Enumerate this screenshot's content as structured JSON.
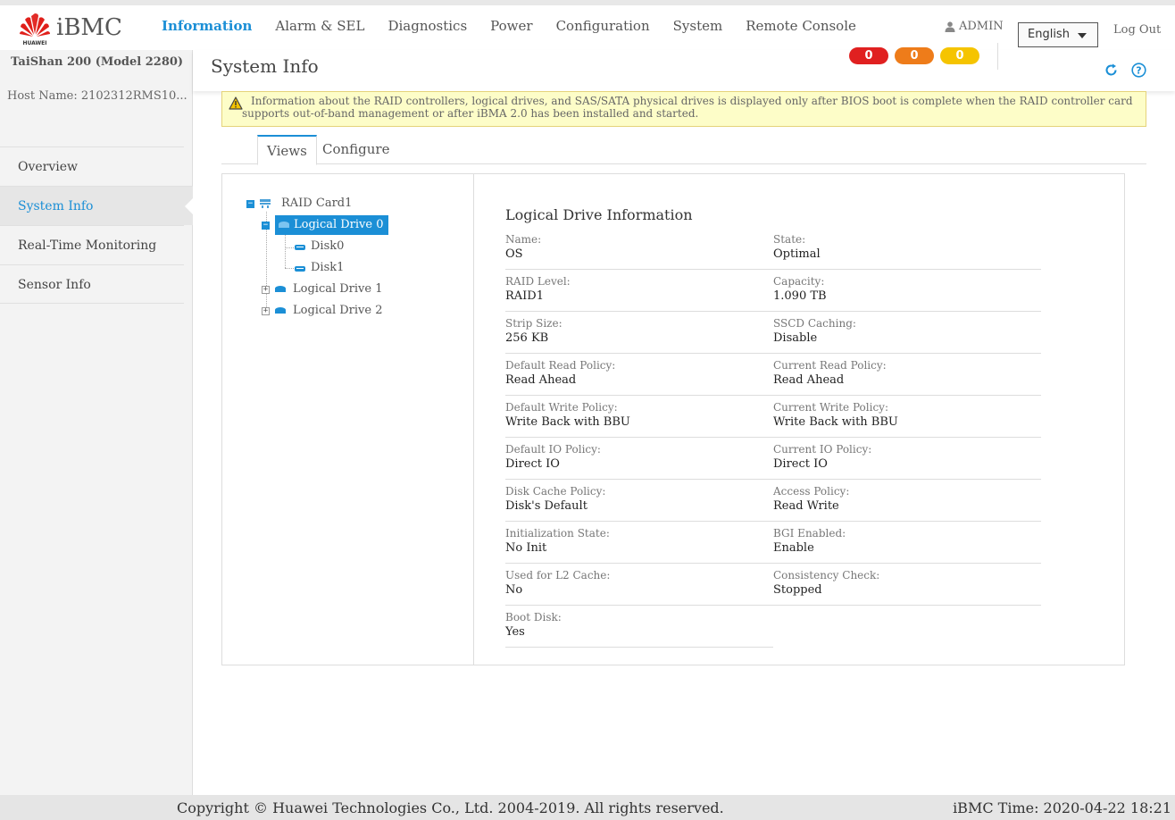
{
  "header": {
    "brand": "iBMC",
    "logo_text": "HUAWEI",
    "nav": [
      "Information",
      "Alarm & SEL",
      "Diagnostics",
      "Power",
      "Configuration",
      "System",
      "Remote Console"
    ],
    "user": "ADMIN",
    "language": "English",
    "logout": "Log Out"
  },
  "sidebar": {
    "model": "TaiShan 200 (Model 2280)",
    "hostname": "Host Name: 2102312RMS10...",
    "items": [
      "Overview",
      "System Info",
      "Real-Time Monitoring",
      "Sensor Info"
    ],
    "active": "System Info"
  },
  "title": {
    "page_title": "System Info",
    "alarms": {
      "critical": "0",
      "major": "0",
      "minor": "0"
    },
    "colors": {
      "critical": "#e02020",
      "major": "#ee7c1a",
      "minor": "#f5c400",
      "accent": "#1b8fd6"
    }
  },
  "warning": "Information about the RAID controllers, logical drives, and SAS/SATA physical drives is displayed only after BIOS boot is complete when the RAID controller card supports out-of-band management or after iBMA 2.0 has been installed and started.",
  "tabs": [
    "Views",
    "Configure"
  ],
  "tree": {
    "root": "RAID Card1",
    "drive0": "Logical Drive 0",
    "disk0": "Disk0",
    "disk1": "Disk1",
    "drive1": "Logical Drive 1",
    "drive2": "Logical Drive 2"
  },
  "detail": {
    "title": "Logical Drive Information",
    "fields": [
      {
        "label": "Name:",
        "value": "OS"
      },
      {
        "label": "State:",
        "value": "Optimal"
      },
      {
        "label": "RAID Level:",
        "value": "RAID1"
      },
      {
        "label": "Capacity:",
        "value": "1.090 TB"
      },
      {
        "label": "Strip Size:",
        "value": "256 KB"
      },
      {
        "label": "SSCD Caching:",
        "value": "Disable"
      },
      {
        "label": "Default Read Policy:",
        "value": "Read Ahead"
      },
      {
        "label": "Current Read Policy:",
        "value": "Read Ahead"
      },
      {
        "label": "Default Write Policy:",
        "value": "Write Back with BBU"
      },
      {
        "label": "Current Write Policy:",
        "value": "Write Back with BBU"
      },
      {
        "label": "Default IO Policy:",
        "value": "Direct IO"
      },
      {
        "label": "Current IO Policy:",
        "value": "Direct IO"
      },
      {
        "label": "Disk Cache Policy:",
        "value": "Disk's Default"
      },
      {
        "label": "Access Policy:",
        "value": "Read Write"
      },
      {
        "label": "Initialization State:",
        "value": "No Init"
      },
      {
        "label": "BGI Enabled:",
        "value": "Enable"
      },
      {
        "label": "Used for L2 Cache:",
        "value": "No"
      },
      {
        "label": "Consistency Check:",
        "value": "Stopped"
      },
      {
        "label": "Boot Disk:",
        "value": "Yes"
      }
    ]
  },
  "footer": {
    "copyright": "Copyright © Huawei Technologies Co., Ltd. 2004-2019. All rights reserved.",
    "time": "iBMC Time: 2020-04-22 18:21"
  }
}
